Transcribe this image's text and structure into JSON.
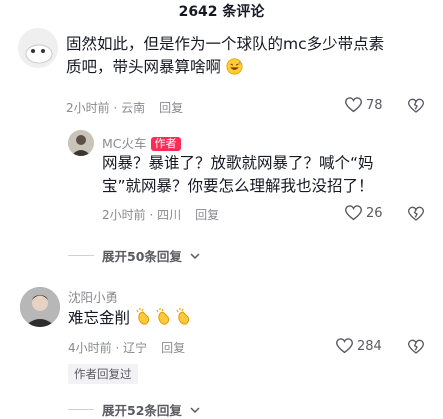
{
  "header": {
    "title": "2642 条评论"
  },
  "comments": [
    {
      "name": "",
      "text_line1": "固然如此，但是作为一个球队的mc多少带点素",
      "text_line2": "质吧，带头网暴算啥啊",
      "emoji": "grinning-sweat-emoji",
      "time": "2小时前 · 云南",
      "reply_label": "回复",
      "likes": "78",
      "replies": [
        {
          "name": "MC火车",
          "badge": "作者",
          "text_line1": "网暴？暴谁了？放歌就网暴了？喊个“妈",
          "text_line2": "宝”就网暴？你要怎么理解我也没招了！",
          "time": "2小时前 · 四川",
          "reply_label": "回复",
          "likes": "26"
        }
      ],
      "expand_label": "展开50条回复"
    },
    {
      "name": "沈阳小勇",
      "text": "难忘金削",
      "emoji": "clapping-hands-emoji",
      "time": "4小时前 · 辽宁",
      "reply_label": "回复",
      "likes": "284",
      "author_replied": "作者回复过",
      "expand_label": "展开52条回复"
    }
  ],
  "colors": {
    "accent": "#fe2c55",
    "text": "#161823",
    "muted": "#8a8b91"
  }
}
